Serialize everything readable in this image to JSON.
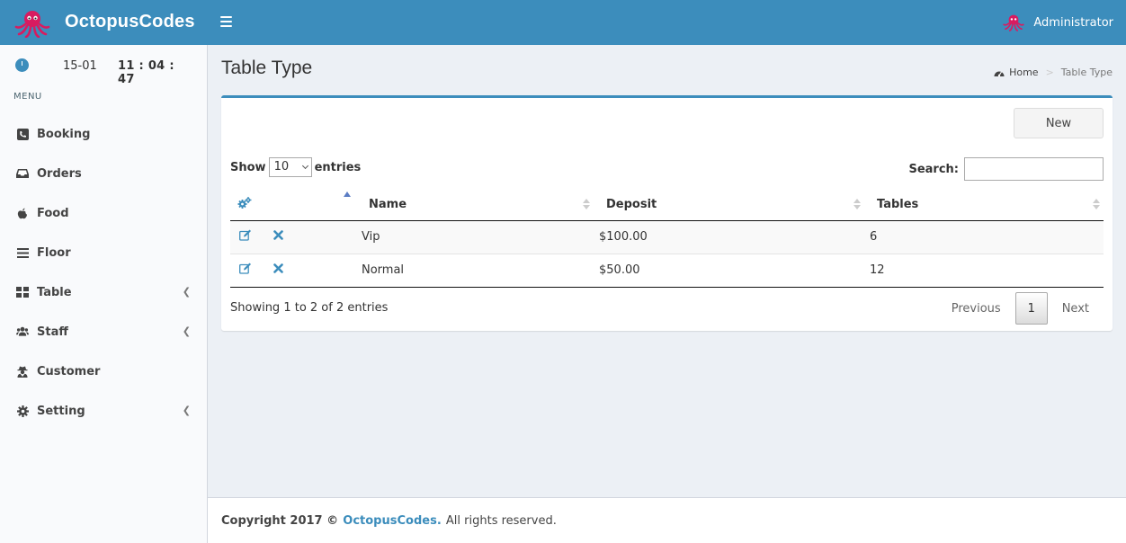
{
  "header": {
    "brand": "OctopusCodes",
    "user": "Administrator"
  },
  "sidebar": {
    "date": "15-01",
    "time": "11 : 04 : 47",
    "menu_header": "MENU",
    "items": [
      {
        "label": "Booking",
        "icon": "phone-icon"
      },
      {
        "label": "Orders",
        "icon": "inbox-icon"
      },
      {
        "label": "Food",
        "icon": "apple-icon"
      },
      {
        "label": "Floor",
        "icon": "bars-icon"
      },
      {
        "label": "Table",
        "icon": "grid-icon",
        "has_submenu": true
      },
      {
        "label": "Staff",
        "icon": "users-icon",
        "has_submenu": true
      },
      {
        "label": "Customer",
        "icon": "user-secret-icon"
      },
      {
        "label": "Setting",
        "icon": "gear-icon",
        "has_submenu": true
      }
    ]
  },
  "page": {
    "title": "Table Type",
    "breadcrumb_home": "Home",
    "breadcrumb_current": "Table Type"
  },
  "box": {
    "new_button": "New",
    "show_label": "Show",
    "entries_label": "entries",
    "page_length": "10",
    "search_label": "Search:",
    "search_value": "",
    "columns": [
      "Name",
      "Deposit",
      "Tables"
    ],
    "rows": [
      {
        "name": "Vip",
        "deposit": "$100.00",
        "tables": "6"
      },
      {
        "name": "Normal",
        "deposit": "$50.00",
        "tables": "12"
      }
    ],
    "info": "Showing 1 to 2 of 2 entries",
    "previous": "Previous",
    "page_number": "1",
    "next": "Next"
  },
  "footer": {
    "prefix": "Copyright 2017 ©",
    "link": "OctopusCodes.",
    "suffix": "All rights reserved."
  },
  "colors": {
    "primary": "#3c8dbc",
    "brand_accent": "#d81b60",
    "sidebar_bg": "#f9fafc",
    "content_bg": "#ecf0f5"
  }
}
